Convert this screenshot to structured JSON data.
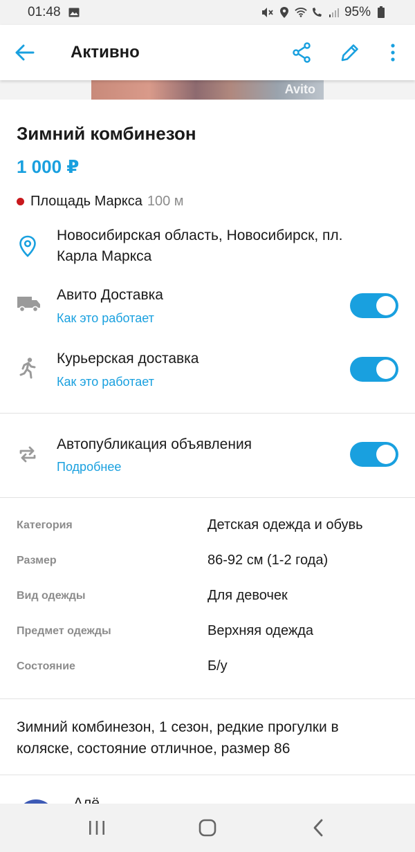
{
  "status_bar": {
    "time": "01:48",
    "battery": "95%",
    "icons": [
      "gallery-icon",
      "mute-icon",
      "location-icon",
      "wifi-icon",
      "wifi-calling-icon",
      "signal-icon",
      "battery-icon"
    ]
  },
  "app_bar": {
    "title": "Активно",
    "icons": [
      "back-arrow-icon",
      "share-icon",
      "edit-pencil-icon",
      "more-vertical-icon"
    ],
    "accent_color": "#19a0df"
  },
  "photo": {
    "watermark": "Avito"
  },
  "listing": {
    "title": "Зимний комбинезон",
    "price": "1 000 ₽",
    "metro_station": "Площадь Маркса",
    "metro_distance": "100 м",
    "metro_color": "#c8191d",
    "address_line1": "Новосибирская область, Новосибирск, пл.",
    "address_line2": "Карла Маркса"
  },
  "options": [
    {
      "label": "Авито Доставка",
      "link": "Как это работает",
      "enabled": true,
      "icon": "truck-icon"
    },
    {
      "label": "Курьерская доставка",
      "link": "Как это работает",
      "enabled": true,
      "icon": "runner-icon"
    },
    {
      "label": "Автопубликация объявления",
      "link": "Подробнее",
      "enabled": true,
      "icon": "repeat-icon"
    }
  ],
  "params": [
    {
      "label": "Категория",
      "value": "Детская одежда и обувь"
    },
    {
      "label": "Размер",
      "value": "86-92 см (1-2 года)"
    },
    {
      "label": "Вид одежды",
      "value": "Для девочек"
    },
    {
      "label": "Предмет одежды",
      "value": "Верхняя одежда"
    },
    {
      "label": "Состояние",
      "value": "Б/у"
    }
  ],
  "description": {
    "line1": "Зимний комбинезон, 1 сезон, редкие прогулки в",
    "line2": "коляске, состояние отличное, размер 86"
  },
  "seller": {
    "name_partial": "Алё"
  },
  "nav_bar": {
    "icons": [
      "recent-apps-icon",
      "home-icon",
      "back-icon"
    ]
  }
}
